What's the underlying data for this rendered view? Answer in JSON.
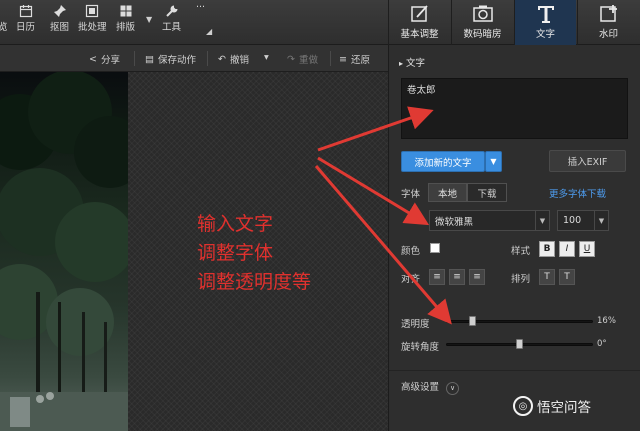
{
  "toolbar": {
    "partial_label": "览",
    "items": [
      {
        "label": "日历",
        "icon": "calendar-icon"
      },
      {
        "label": "抠图",
        "icon": "pin-icon"
      },
      {
        "label": "批处理",
        "icon": "batch-icon"
      },
      {
        "label": "排版",
        "icon": "layout-icon"
      },
      {
        "label": "工具",
        "icon": "wrench-icon"
      },
      {
        "label": "···",
        "icon": "more-icon"
      }
    ]
  },
  "right_tabs": [
    {
      "label": "基本调整",
      "icon": "adjust-icon"
    },
    {
      "label": "数码暗房",
      "icon": "camera-icon"
    },
    {
      "label": "文字",
      "icon": "text-icon",
      "active": true
    },
    {
      "label": "水印",
      "icon": "watermark-icon"
    }
  ],
  "secondary_bar": {
    "share": "分享",
    "save_action": "保存动作",
    "undo": "撤销",
    "redo": "重做",
    "restore": "还原"
  },
  "annotation": {
    "line1": "输入文字",
    "line2": "调整字体",
    "line3": "调整透明度等",
    "color": "#e0312e"
  },
  "panel": {
    "section_title": "文字",
    "text_value": "卷太郎",
    "add_text_button": "添加新的文字",
    "insert_exif_button": "插入EXIF",
    "font_label": "字体",
    "font_local_tab": "本地",
    "font_download_tab": "下载",
    "more_fonts_link": "更多字体下载",
    "font_family": "微软雅黑",
    "font_size": "100",
    "color_label": "颜色",
    "color_value": "#ffffff",
    "style_label": "样式",
    "style_bold": "B",
    "style_italic": "I",
    "style_underline": "U",
    "align_label": "对齐",
    "arrange_label": "排列",
    "opacity_label": "透明度",
    "opacity_value": "16%",
    "opacity_level": 0.16,
    "rotation_label": "旋转角度",
    "rotation_value": "0°",
    "advanced_label": "高级设置"
  },
  "watermark": {
    "text": "悟空问答"
  },
  "colors": {
    "accent": "#3a8ee0",
    "link": "#4e9df0",
    "active_tab": "#1f3550"
  }
}
